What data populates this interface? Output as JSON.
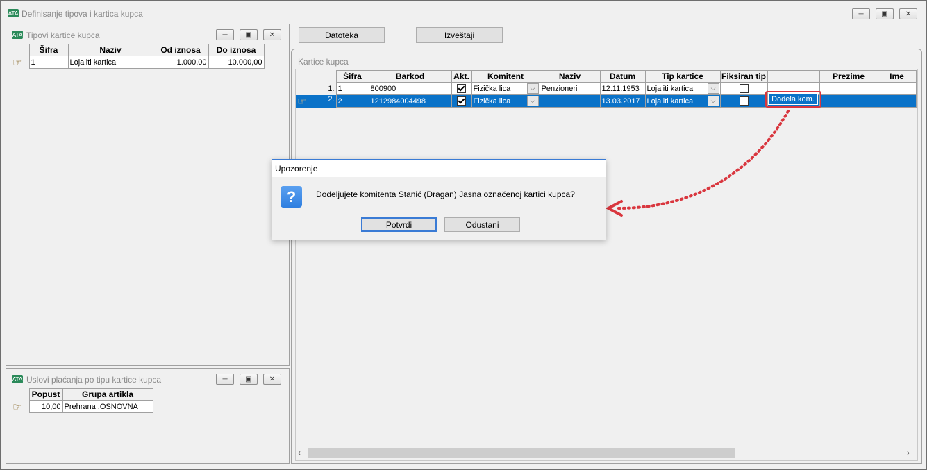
{
  "main_window": {
    "title": "Definisanje tipova i kartica kupca"
  },
  "tipovi_panel": {
    "title": "Tipovi kartice kupca",
    "columns": [
      "Šifra",
      "Naziv",
      "Od iznosa",
      "Do iznosa"
    ],
    "rows": [
      {
        "sifra": "1",
        "naziv": "Lojaliti kartica",
        "od": "1.000,00",
        "do": "10.000,00"
      }
    ]
  },
  "uslovi_panel": {
    "title": "Uslovi plaćanja po tipu kartice kupca",
    "columns": [
      "Popust",
      "Grupa artikla"
    ],
    "rows": [
      {
        "popust": "10,00",
        "grupa": "Prehrana ,OSNOVNA"
      }
    ]
  },
  "toolbar": {
    "datoteka": "Datoteka",
    "izvestaji": "Izveštaji"
  },
  "kartice_panel": {
    "title": "Kartice kupca",
    "columns": [
      "Šifra",
      "Barkod",
      "Akt.",
      "Komitent",
      "Naziv",
      "Datum",
      "Tip kartice",
      "Fiksiran tip",
      "",
      "Prezime",
      "Ime"
    ],
    "rows": [
      {
        "num": "1.",
        "sifra": "1",
        "barkod": "800900",
        "akt": true,
        "komitent": "Fizička lica",
        "naziv": "Penzioneri",
        "datum": "12.11.1953",
        "tip": "Lojaliti kartica",
        "fiksiran": false
      },
      {
        "num": "2.",
        "sifra": "2",
        "barkod": "1212984004498",
        "akt": true,
        "komitent": "Fizička lica",
        "naziv": "",
        "datum": "13.03.2017",
        "tip": "Lojaliti kartica",
        "fiksiran": false,
        "action": "Dodela kom."
      }
    ]
  },
  "dialog": {
    "title": "Upozorenje",
    "message": "Dodeljujete komitenta Stanić (Dragan) Jasna označenoj kartici kupca?",
    "icon": "question-icon",
    "confirm": "Potvrdi",
    "cancel": "Odustani"
  },
  "colors": {
    "selection": "#0a72c8",
    "highlight": "#d9363e",
    "dialog_icon": "#2f7fe0"
  }
}
